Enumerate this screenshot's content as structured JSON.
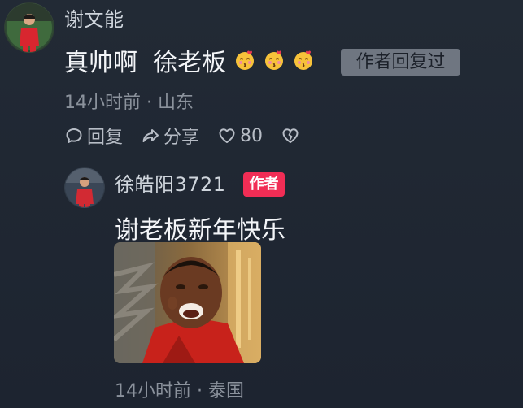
{
  "comment": {
    "username": "谢文能",
    "text": "真帅啊  徐老板",
    "emojis": [
      "kiss-face-icon",
      "kiss-face-icon",
      "kiss-face-icon"
    ],
    "author_replied_badge": "作者回复过",
    "meta": "14小时前 · 山东",
    "actions": {
      "reply_label": "回复",
      "share_label": "分享",
      "like_count": "80"
    }
  },
  "reply": {
    "username": "徐皓阳3721",
    "author_badge": "作者",
    "text": "谢老板新年快乐",
    "meta": "14小时前 · 泰国"
  },
  "colors": {
    "background": "#1f2631",
    "author_badge": "#f12d55",
    "replied_badge": "#6f7681",
    "meta_text": "#8b929c"
  }
}
